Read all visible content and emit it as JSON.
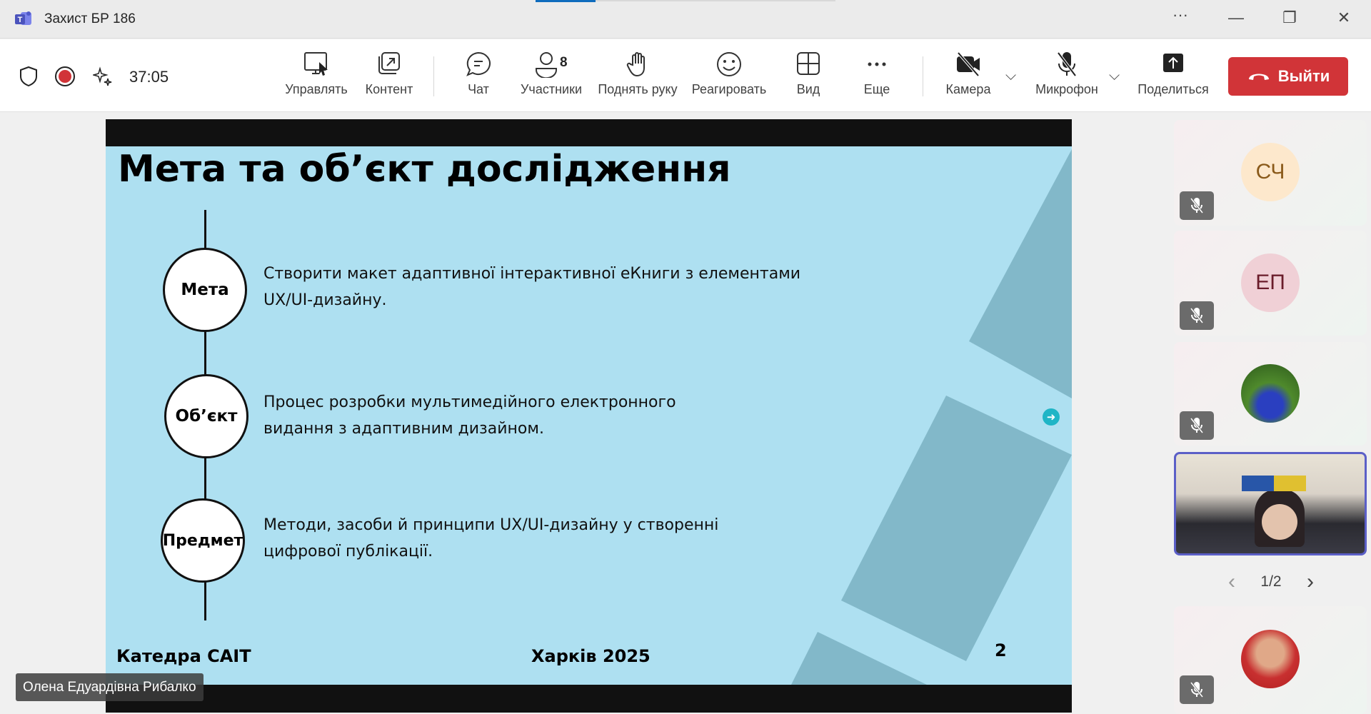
{
  "window": {
    "title": "Захист БР 186",
    "more": "···",
    "minimize": "—",
    "restore": "❐",
    "close": "✕"
  },
  "toolbar": {
    "timer": "37:05",
    "items": [
      {
        "label": "Управлять",
        "icon": "manage-icon"
      },
      {
        "label": "Контент",
        "icon": "content-icon"
      },
      {
        "label": "Чат",
        "icon": "chat-icon"
      },
      {
        "label": "Участники",
        "icon": "people-icon",
        "count": "8"
      },
      {
        "label": "Поднять руку",
        "icon": "hand-icon"
      },
      {
        "label": "Реагировать",
        "icon": "smile-icon"
      },
      {
        "label": "Вид",
        "icon": "grid-icon"
      },
      {
        "label": "Еще",
        "icon": "more-icon"
      },
      {
        "label": "Камера",
        "icon": "camera-off-icon"
      },
      {
        "label": "Микрофон",
        "icon": "mic-off-icon"
      },
      {
        "label": "Поделиться",
        "icon": "share-icon"
      }
    ],
    "leave": "Выйти",
    "leave_color": "#d13438"
  },
  "slide": {
    "title": "Мета та об’єкт дослідження",
    "items": [
      {
        "label": "Мета",
        "lines": [
          "Створити макет адаптивної інтерактивної еКниги з елементами",
          "UX/UI-дизайну."
        ]
      },
      {
        "label": "Об’єкт",
        "lines": [
          "Процес розробки мультимедійного електронного",
          "видання з адаптивним дизайном."
        ]
      },
      {
        "label": "Предмет",
        "lines": [
          "Методи, засоби й принципи UX/UI-дизайну у створенні",
          "цифрової публікації."
        ]
      }
    ],
    "footer_left": "Катедра САІТ",
    "footer_center": "Харків 2025",
    "page_number": "2",
    "background": "#aee0f1"
  },
  "presenter_name": "Олена Едуардівна Рибалко",
  "participants": [
    {
      "initials": "СЧ"
    },
    {
      "initials": "ЕП"
    }
  ],
  "pager": {
    "text": "1/2",
    "prev": "‹",
    "next": "›"
  }
}
